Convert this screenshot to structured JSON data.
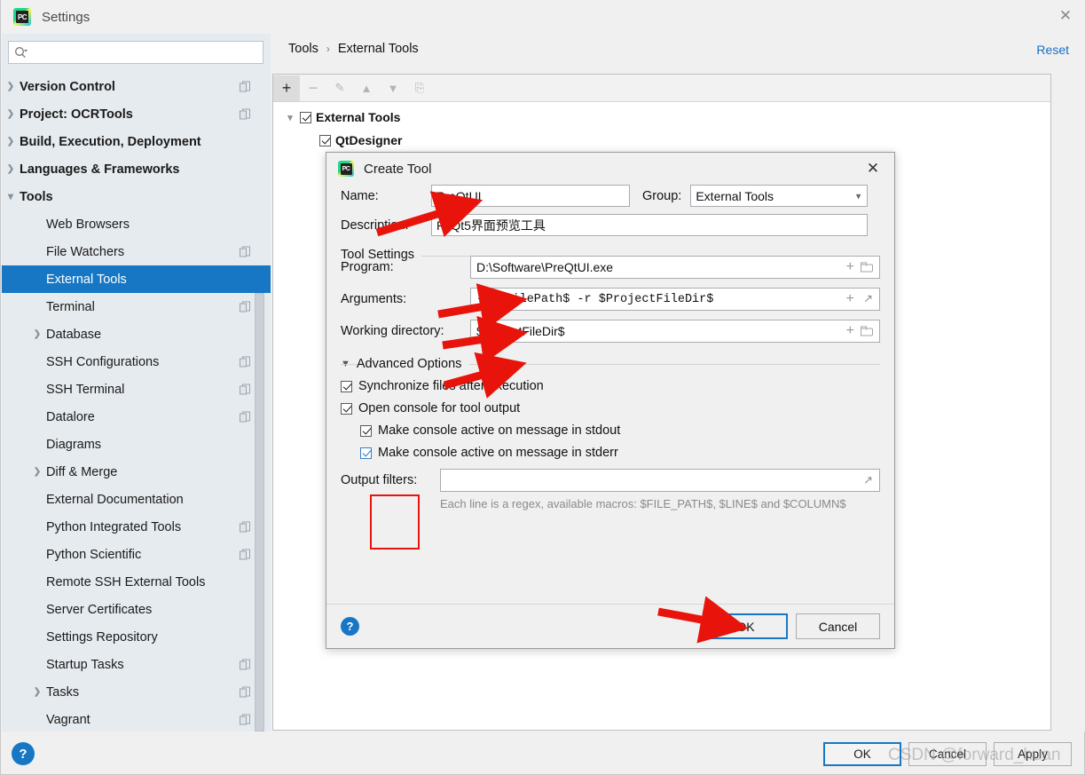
{
  "window": {
    "title": "Settings",
    "app_icon": "pycharm-icon",
    "close_icon": "close-icon"
  },
  "search": {
    "value": "",
    "placeholder": "",
    "icon": "search-icon"
  },
  "sidebar": {
    "items": [
      {
        "label": "Version Control",
        "indent": 0,
        "arrow": "closed",
        "bold": true,
        "badge": true,
        "selected": false
      },
      {
        "label": "Project: OCRTools",
        "indent": 0,
        "arrow": "closed",
        "bold": true,
        "badge": true,
        "selected": false
      },
      {
        "label": "Build, Execution, Deployment",
        "indent": 0,
        "arrow": "closed",
        "bold": true,
        "badge": false,
        "selected": false
      },
      {
        "label": "Languages & Frameworks",
        "indent": 0,
        "arrow": "closed",
        "bold": true,
        "badge": false,
        "selected": false
      },
      {
        "label": "Tools",
        "indent": 0,
        "arrow": "open",
        "bold": true,
        "badge": false,
        "selected": false
      },
      {
        "label": "Web Browsers",
        "indent": 1,
        "arrow": "none",
        "bold": false,
        "badge": false,
        "selected": false
      },
      {
        "label": "File Watchers",
        "indent": 1,
        "arrow": "none",
        "bold": false,
        "badge": true,
        "selected": false
      },
      {
        "label": "External Tools",
        "indent": 1,
        "arrow": "none",
        "bold": false,
        "badge": false,
        "selected": true
      },
      {
        "label": "Terminal",
        "indent": 1,
        "arrow": "none",
        "bold": false,
        "badge": true,
        "selected": false
      },
      {
        "label": "Database",
        "indent": 1,
        "arrow": "closed",
        "bold": false,
        "badge": false,
        "selected": false
      },
      {
        "label": "SSH Configurations",
        "indent": 1,
        "arrow": "none",
        "bold": false,
        "badge": true,
        "selected": false
      },
      {
        "label": "SSH Terminal",
        "indent": 1,
        "arrow": "none",
        "bold": false,
        "badge": true,
        "selected": false
      },
      {
        "label": "Datalore",
        "indent": 1,
        "arrow": "none",
        "bold": false,
        "badge": true,
        "selected": false
      },
      {
        "label": "Diagrams",
        "indent": 1,
        "arrow": "none",
        "bold": false,
        "badge": false,
        "selected": false
      },
      {
        "label": "Diff & Merge",
        "indent": 1,
        "arrow": "closed",
        "bold": false,
        "badge": false,
        "selected": false
      },
      {
        "label": "External Documentation",
        "indent": 1,
        "arrow": "none",
        "bold": false,
        "badge": false,
        "selected": false
      },
      {
        "label": "Python Integrated Tools",
        "indent": 1,
        "arrow": "none",
        "bold": false,
        "badge": true,
        "selected": false
      },
      {
        "label": "Python Scientific",
        "indent": 1,
        "arrow": "none",
        "bold": false,
        "badge": true,
        "selected": false
      },
      {
        "label": "Remote SSH External Tools",
        "indent": 1,
        "arrow": "none",
        "bold": false,
        "badge": false,
        "selected": false
      },
      {
        "label": "Server Certificates",
        "indent": 1,
        "arrow": "none",
        "bold": false,
        "badge": false,
        "selected": false
      },
      {
        "label": "Settings Repository",
        "indent": 1,
        "arrow": "none",
        "bold": false,
        "badge": false,
        "selected": false
      },
      {
        "label": "Startup Tasks",
        "indent": 1,
        "arrow": "none",
        "bold": false,
        "badge": true,
        "selected": false
      },
      {
        "label": "Tasks",
        "indent": 1,
        "arrow": "closed",
        "bold": false,
        "badge": true,
        "selected": false
      },
      {
        "label": "Vagrant",
        "indent": 1,
        "arrow": "none",
        "bold": false,
        "badge": true,
        "selected": false
      }
    ],
    "help_icon": "help-icon"
  },
  "content": {
    "breadcrumb": {
      "parent": "Tools",
      "separator": "›",
      "current": "External Tools"
    },
    "reset_label": "Reset",
    "toolbar": [
      {
        "name": "add-button",
        "glyph": "+",
        "active": true
      },
      {
        "name": "remove-button",
        "glyph": "−",
        "active": false
      },
      {
        "name": "edit-button",
        "glyph": "✎",
        "active": false
      },
      {
        "name": "move-up-button",
        "glyph": "▲",
        "active": false
      },
      {
        "name": "move-down-button",
        "glyph": "▼",
        "active": false
      },
      {
        "name": "copy-button",
        "glyph": "⎘",
        "active": false
      }
    ],
    "tree": [
      {
        "label": "External Tools",
        "checked": true,
        "arrow": "open",
        "indent": 0
      },
      {
        "label": "QtDesigner",
        "checked": true,
        "arrow": "none",
        "indent": 1
      }
    ]
  },
  "footer": {
    "ok_label": "OK",
    "cancel_label": "Cancel",
    "apply_label": "Apply",
    "watermark": "CSDN @forward_huan"
  },
  "dialog": {
    "title": "Create Tool",
    "icon": "pycharm-icon",
    "close_icon": "close-icon",
    "name_label": "Name:",
    "name_value": "PreQtUI",
    "group_label": "Group:",
    "group_value": "External Tools",
    "description_label": "Description:",
    "description_value": "PyQt5界面预览工具",
    "tool_settings_title": "Tool Settings",
    "program_label": "Program:",
    "program_value": "D:\\Software\\PreQtUI.exe",
    "arguments_label": "Arguments:",
    "arguments_value": "-f $FilePath$ -r $ProjectFileDir$",
    "working_dir_label": "Working directory:",
    "working_dir_value": "$ProjectFileDir$",
    "advanced_title": "Advanced Options",
    "options": [
      {
        "label": "Synchronize files after execution",
        "checked": true,
        "indent": false,
        "blue": false
      },
      {
        "label": "Open console for tool output",
        "checked": true,
        "indent": false,
        "blue": false
      },
      {
        "label": "Make console active on message in stdout",
        "checked": true,
        "indent": true,
        "blue": false
      },
      {
        "label": "Make console active on message in stderr",
        "checked": true,
        "indent": true,
        "blue": true
      }
    ],
    "output_filters_label": "Output filters:",
    "output_filters_value": "",
    "hint": "Each line is a regex, available macros: $FILE_PATH$, $LINE$ and $COLUMN$",
    "help_icon": "help-icon",
    "ok_label": "OK",
    "cancel_label": "Cancel"
  },
  "colors": {
    "accent": "#1777c4",
    "sidebar_bg": "#e6ebef",
    "panel_bg": "#f0f0f0",
    "annotation_red": "#e8140b",
    "link": "#1a6fc4"
  }
}
